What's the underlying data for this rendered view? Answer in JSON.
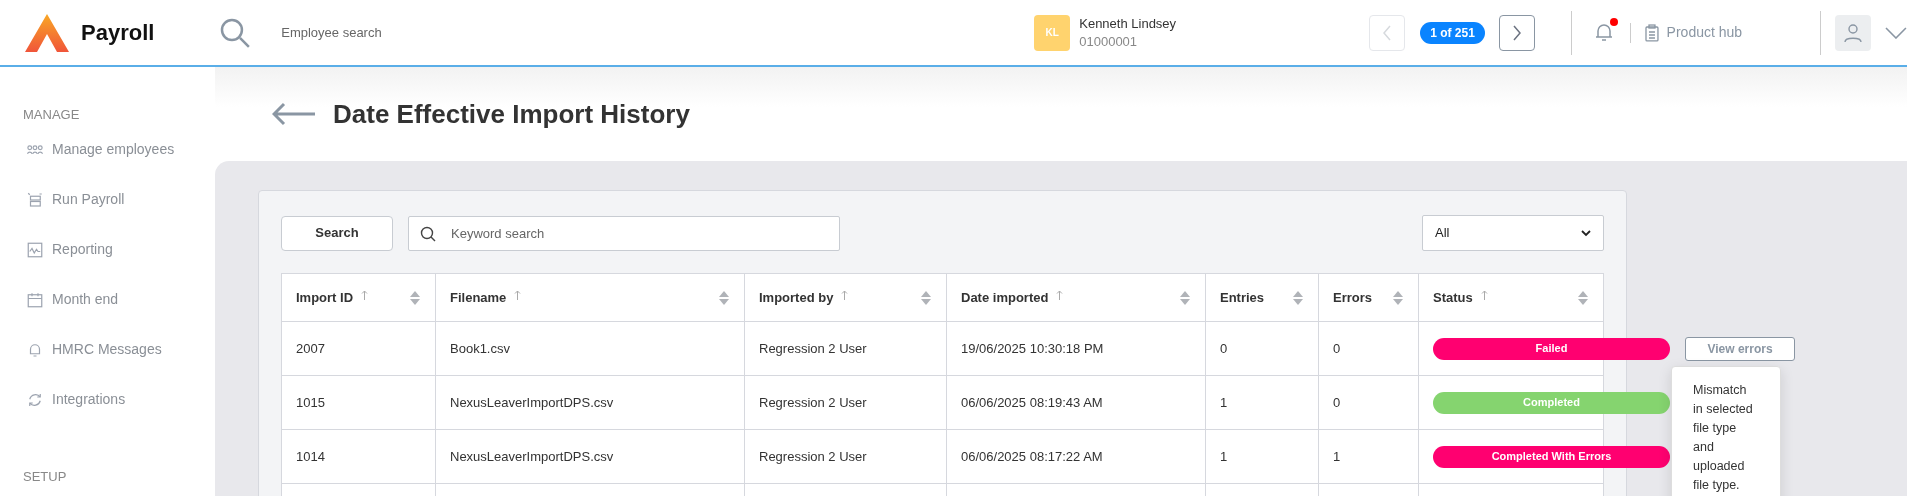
{
  "app": {
    "name": "Payroll"
  },
  "header": {
    "search_placeholder": "Employee search",
    "employee": {
      "initials": "KL",
      "name": "Kenneth Lindsey",
      "number": "01000001"
    },
    "pager": {
      "label": "1 of 251",
      "prev_disabled": true,
      "next_disabled": false
    },
    "notifications": {
      "unread": true
    },
    "product_hub": "Product hub"
  },
  "sidebar": {
    "sections": [
      {
        "title": "MANAGE",
        "items": [
          {
            "label": "Manage employees",
            "kind": "people"
          },
          {
            "label": "Run Payroll",
            "kind": "payroll"
          },
          {
            "label": "Reporting",
            "kind": "chart"
          },
          {
            "label": "Month end",
            "kind": "calendar"
          },
          {
            "label": "HMRC Messages",
            "kind": "bell"
          },
          {
            "label": "Integrations",
            "kind": "sync"
          }
        ]
      },
      {
        "title": "SETUP"
      }
    ]
  },
  "page": {
    "title": "Date Effective Import History"
  },
  "toolbar": {
    "search_button": "Search",
    "keyword_placeholder": "Keyword search",
    "filter": "All"
  },
  "table": {
    "columns": [
      {
        "label": "Import ID",
        "sort_arrow": true
      },
      {
        "label": "Filename",
        "sort_arrow": true
      },
      {
        "label": "Imported by",
        "sort_arrow": true
      },
      {
        "label": "Date imported",
        "sort_arrow": true
      },
      {
        "label": "Entries",
        "sort_arrow": false
      },
      {
        "label": "Errors",
        "sort_arrow": false
      },
      {
        "label": "Status",
        "sort_arrow": true
      }
    ],
    "rows": [
      {
        "cells": [
          "2007",
          "Book1.csv",
          "Regression 2 User",
          "19/06/2025 10:30:18 PM",
          "0",
          "0"
        ],
        "status": {
          "label": "Failed",
          "color": "#ff0070"
        },
        "action": "View errors",
        "tooltip": "Mismatch in selected file type and uploaded file type."
      },
      {
        "cells": [
          "1015",
          "NexusLeaverImportDPS.csv",
          "Regression 2 User",
          "06/06/2025 08:19:43 AM",
          "1",
          "0"
        ],
        "status": {
          "label": "Completed",
          "color": "#85d46f"
        }
      },
      {
        "cells": [
          "1014",
          "NexusLeaverImportDPS.csv",
          "Regression 2 User",
          "06/06/2025 08:17:22 AM",
          "1",
          "1"
        ],
        "status": {
          "label": "Completed With Errors",
          "color": "#ff0070"
        }
      }
    ]
  }
}
